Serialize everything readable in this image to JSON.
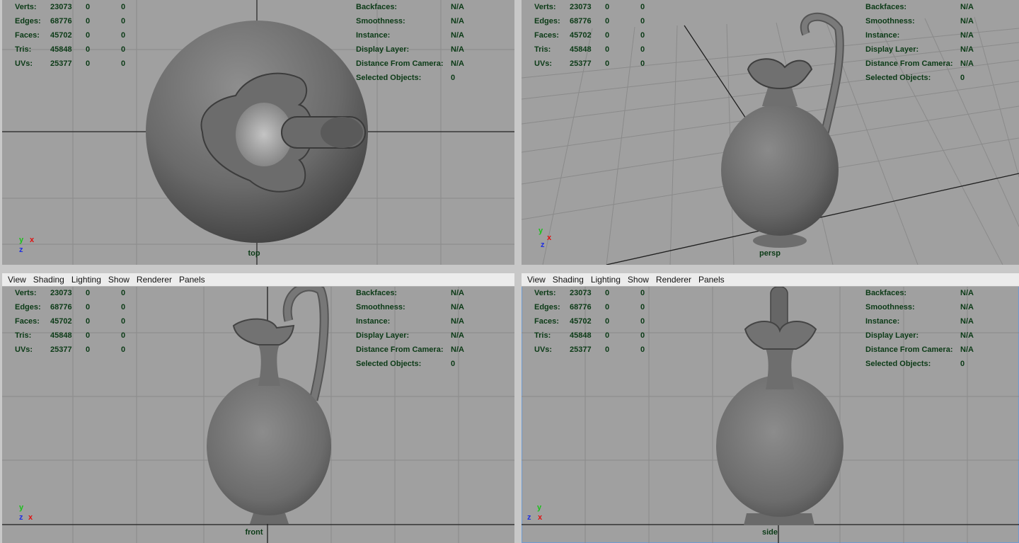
{
  "menu": [
    "View",
    "Shading",
    "Lighting",
    "Show",
    "Renderer",
    "Panels"
  ],
  "hud_left": [
    {
      "label": "Verts:",
      "v1": "23073",
      "v2": "0",
      "v3": "0"
    },
    {
      "label": "Edges:",
      "v1": "68776",
      "v2": "0",
      "v3": "0"
    },
    {
      "label": "Faces:",
      "v1": "45702",
      "v2": "0",
      "v3": "0"
    },
    {
      "label": "Tris:",
      "v1": "45848",
      "v2": "0",
      "v3": "0"
    },
    {
      "label": "UVs:",
      "v1": "25377",
      "v2": "0",
      "v3": "0"
    }
  ],
  "hud_right": [
    {
      "label": "Backfaces:",
      "value": "N/A"
    },
    {
      "label": "Smoothness:",
      "value": "N/A"
    },
    {
      "label": "Instance:",
      "value": "N/A"
    },
    {
      "label": "Display Layer:",
      "value": "N/A"
    },
    {
      "label": "Distance From Camera:",
      "value": "N/A"
    },
    {
      "label": "Selected Objects:",
      "value": "0"
    }
  ],
  "panes": {
    "top": {
      "camera": "top",
      "axes": [
        "y",
        "x",
        "z"
      ]
    },
    "persp": {
      "camera": "persp",
      "axes": [
        "y",
        "x",
        "z"
      ]
    },
    "front": {
      "camera": "front",
      "axes": [
        "y",
        "z",
        "x"
      ]
    },
    "side": {
      "camera": "side",
      "axes": [
        "y",
        "z",
        "x"
      ]
    }
  },
  "colors": {
    "hud_text": "#0b3a16",
    "viewport_bg": "#a0a0a0",
    "grid": "#8c8c8c",
    "active_border": "#6f9bd1"
  }
}
